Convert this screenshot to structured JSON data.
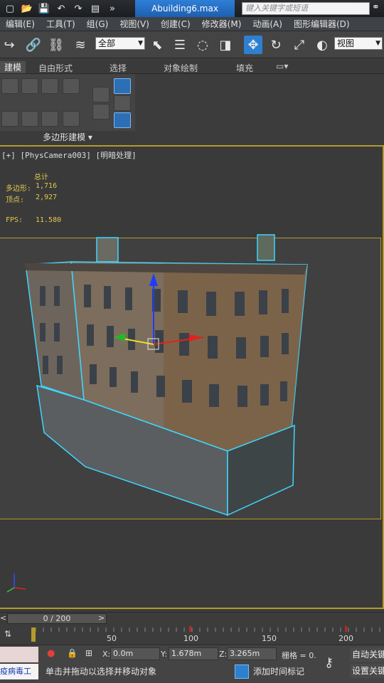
{
  "titlebar": {
    "file_name": "Abuilding6.max",
    "search_placeholder": "键入关键字或短语"
  },
  "menu": [
    "编辑(E)",
    "工具(T)",
    "组(G)",
    "视图(V)",
    "创建(C)",
    "修改器(M)",
    "动画(A)",
    "图形编辑器(D)"
  ],
  "toolbar": {
    "selection_filter": "全部",
    "reference_coord": "视图"
  },
  "ribbon": {
    "tabs": [
      "建模",
      "自由形式",
      "选择",
      "对象绘制",
      "填充"
    ],
    "panel_label": "多边形建模 ▾"
  },
  "viewport": {
    "label": "[+] [PhysCamera003] [明暗处理]",
    "stats": {
      "header": "总计",
      "polys_label": "多边形:",
      "polys_value": "1,716",
      "verts_label": "顶点:",
      "verts_value": "2,927",
      "fps_label": "FPS:",
      "fps_value": "11.580"
    }
  },
  "timeline": {
    "slider_text": "0 / 200",
    "ticks": [
      "50",
      "100",
      "150",
      "200"
    ]
  },
  "statusbar": {
    "x_label": "X:",
    "x_value": "0.0m",
    "y_label": "Y:",
    "y_value": "1.678m",
    "z_label": "Z:",
    "z_value": "3.265m",
    "grid_label": "栅格 = 0.",
    "auto_key": "自动关键",
    "set_key": "设置关键",
    "prompt": "单击并拖动以选择并移动对象",
    "add_time_tag": "添加时间标记",
    "listener_text": "疫病毒工"
  },
  "colors": {
    "selection_outline": "#3fd6ff",
    "frame": "#b39a2c",
    "accent_blue": "#2d7fd0",
    "stats_yellow": "#e3c84a"
  }
}
